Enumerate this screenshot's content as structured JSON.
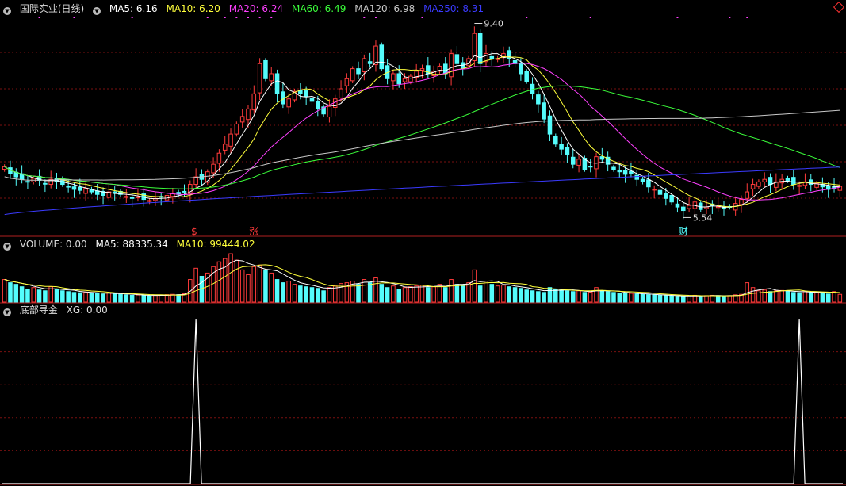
{
  "colors": {
    "up": "#ff3b3b",
    "down": "#54fcfc",
    "ma5": "#ffffff",
    "ma10": "#ffff3b",
    "ma20": "#ff40ff",
    "ma60": "#3bff3b",
    "ma120": "#c8c8c8",
    "ma250": "#3b3bff",
    "grid": "#7a1010",
    "border": "#b02020"
  },
  "header": {
    "stock_title": "国际实业(日线)",
    "ma5": "MA5: 6.16",
    "ma10": "MA10: 6.20",
    "ma20": "MA20: 6.24",
    "ma60": "MA60: 6.49",
    "ma120": "MA120: 6.98",
    "ma250": "MA250: 8.31"
  },
  "volume_header": {
    "title": "VOLUME: 0.00",
    "ma5": "MA5: 88335.34",
    "ma10": "MA10: 99444.02"
  },
  "indicator_header": {
    "title": "底部寻金",
    "xg": "XG: 0.00"
  },
  "chart_data": [
    {
      "type": "candlestick",
      "price_range": [
        5.2,
        9.55
      ],
      "high_label": "9.40",
      "low_label": "5.54",
      "markers": [
        {
          "text": "$",
          "color": "#ff3b3b",
          "bar": 33
        },
        {
          "text": "涨",
          "color": "#ff3b3b",
          "bar": 43
        },
        {
          "text": "财",
          "color": "#54fcfc",
          "bar": 117
        }
      ],
      "closes": [
        6.55,
        6.42,
        6.35,
        6.3,
        6.25,
        6.32,
        6.28,
        6.22,
        6.3,
        6.25,
        6.2,
        6.15,
        6.1,
        6.08,
        6.12,
        6.05,
        6.0,
        5.98,
        6.05,
        6.02,
        6.0,
        5.96,
        5.92,
        5.95,
        5.9,
        5.88,
        5.92,
        5.95,
        5.98,
        6.02,
        6.0,
        6.05,
        6.2,
        6.35,
        6.3,
        6.45,
        6.6,
        6.82,
        7.0,
        7.2,
        7.4,
        7.55,
        7.7,
        8.0,
        8.6,
        8.3,
        8.4,
        8.0,
        7.8,
        7.9,
        8.05,
        8.0,
        7.95,
        7.85,
        7.7,
        7.6,
        7.75,
        7.9,
        8.1,
        8.3,
        8.5,
        8.4,
        8.7,
        8.6,
        8.95,
        8.5,
        8.3,
        8.4,
        8.2,
        8.3,
        8.35,
        8.45,
        8.5,
        8.4,
        8.45,
        8.55,
        8.4,
        8.8,
        8.6,
        8.5,
        8.7,
        9.2,
        8.6,
        8.8,
        8.7,
        8.7,
        8.8,
        8.7,
        8.6,
        8.4,
        8.25,
        8.0,
        7.8,
        7.5,
        7.2,
        7.0,
        6.9,
        6.8,
        6.6,
        6.7,
        6.5,
        6.55,
        6.75,
        6.7,
        6.6,
        6.5,
        6.45,
        6.4,
        6.42,
        6.3,
        6.25,
        6.15,
        6.1,
        6.0,
        5.92,
        5.85,
        5.75,
        5.68,
        5.78,
        5.85,
        5.7,
        5.75,
        5.78,
        5.76,
        5.72,
        5.75,
        5.82,
        5.9,
        6.05,
        6.2,
        6.25,
        6.3,
        6.2,
        6.25,
        6.3,
        6.28,
        6.2,
        6.18,
        6.25,
        6.2,
        6.22,
        6.15,
        6.1,
        6.12,
        6.16
      ]
    },
    {
      "type": "bar",
      "name": "VOLUME",
      "note_ranges": [
        0,
        310000
      ],
      "values": [
        140000,
        120000,
        110000,
        95000,
        80000,
        90000,
        75000,
        70000,
        95000,
        80000,
        70000,
        65000,
        60000,
        58000,
        62000,
        55000,
        52000,
        50000,
        58000,
        52000,
        48000,
        45000,
        42000,
        44000,
        40000,
        38000,
        42000,
        44000,
        46000,
        48000,
        46000,
        52000,
        140000,
        210000,
        160000,
        180000,
        220000,
        250000,
        270000,
        300000,
        260000,
        200000,
        170000,
        220000,
        230000,
        200000,
        180000,
        140000,
        120000,
        130000,
        110000,
        100000,
        95000,
        90000,
        85000,
        70000,
        90000,
        100000,
        115000,
        120000,
        130000,
        110000,
        140000,
        120000,
        150000,
        110000,
        90000,
        100000,
        80000,
        90000,
        95000,
        100000,
        105000,
        90000,
        95000,
        110000,
        90000,
        140000,
        110000,
        100000,
        120000,
        200000,
        100000,
        130000,
        110000,
        100000,
        105000,
        95000,
        90000,
        85000,
        75000,
        70000,
        65000,
        60000,
        90000,
        80000,
        75000,
        70000,
        65000,
        70000,
        60000,
        62000,
        90000,
        70000,
        65000,
        60000,
        55000,
        52000,
        54000,
        50000,
        48000,
        46000,
        44000,
        42000,
        40000,
        38000,
        36000,
        35000,
        40000,
        42000,
        38000,
        40000,
        42000,
        40000,
        38000,
        40000,
        45000,
        48000,
        120000,
        90000,
        70000,
        75000,
        65000,
        70000,
        72000,
        68000,
        60000,
        58000,
        65000,
        60000,
        62000,
        55000,
        50000,
        65000,
        48000
      ]
    },
    {
      "type": "line",
      "name": "底部寻金",
      "values": "spikes",
      "spike_bars": [
        33,
        137
      ],
      "xg_range": [
        0,
        1
      ]
    }
  ]
}
